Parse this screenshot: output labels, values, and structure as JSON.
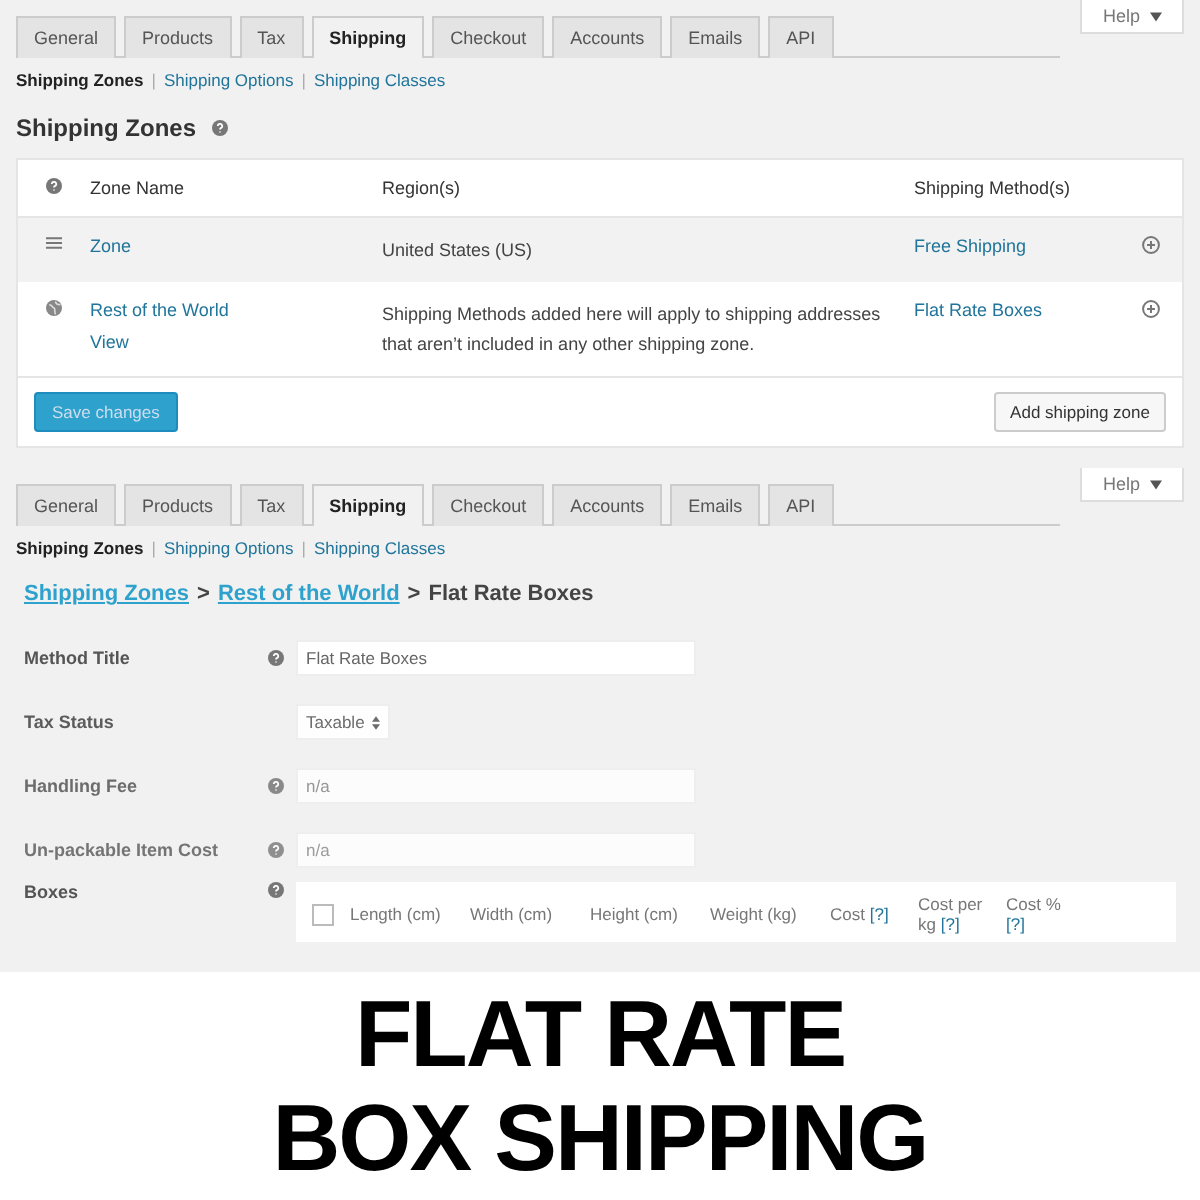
{
  "zones_screen": {
    "help_button": "Help",
    "tabs": [
      {
        "label": "General",
        "selected": false
      },
      {
        "label": "Products",
        "selected": false
      },
      {
        "label": "Tax",
        "selected": false
      },
      {
        "label": "Shipping",
        "selected": true
      },
      {
        "label": "Checkout",
        "selected": false
      },
      {
        "label": "Accounts",
        "selected": false
      },
      {
        "label": "Emails",
        "selected": false
      },
      {
        "label": "API",
        "selected": false
      }
    ],
    "subnav": [
      {
        "label": "Shipping Zones",
        "selected": true
      },
      {
        "label": "Shipping Options",
        "selected": false
      },
      {
        "label": "Shipping Classes",
        "selected": false
      }
    ],
    "subnav_separator": "|",
    "title": "Shipping Zones",
    "columns": [
      "Zone Name",
      "Region(s)",
      "Shipping Method(s)"
    ],
    "rows": [
      {
        "kind": "zone",
        "name": "Zone",
        "region": "United States (US)",
        "method": "Free Shipping",
        "highlighted": true
      },
      {
        "kind": "world",
        "name": "Rest of the World",
        "action": "View",
        "region": "Shipping Methods added here will apply to shipping addresses that aren’t included in any other shipping zone.",
        "method": "Flat Rate Boxes",
        "highlighted": false
      }
    ],
    "save_button": "Save changes",
    "add_button": "Add shipping zone"
  },
  "method_screen": {
    "help_button": "Help",
    "tabs": [
      {
        "label": "General",
        "selected": false
      },
      {
        "label": "Products",
        "selected": false
      },
      {
        "label": "Tax",
        "selected": false
      },
      {
        "label": "Shipping",
        "selected": true
      },
      {
        "label": "Checkout",
        "selected": false
      },
      {
        "label": "Accounts",
        "selected": false
      },
      {
        "label": "Emails",
        "selected": false
      },
      {
        "label": "API",
        "selected": false
      }
    ],
    "subnav": [
      {
        "label": "Shipping Zones",
        "selected": true
      },
      {
        "label": "Shipping Options",
        "selected": false
      },
      {
        "label": "Shipping Classes",
        "selected": false
      }
    ],
    "subnav_separator": "|",
    "breadcrumb_separator": ">",
    "breadcrumb": [
      {
        "label": "Shipping Zones",
        "link": true
      },
      {
        "label": "Rest of the World",
        "link": true
      },
      {
        "label": "Flat Rate Boxes",
        "link": false
      }
    ],
    "fields": [
      {
        "kind": "text",
        "label": "Method Title",
        "value": "Flat Rate Boxes"
      },
      {
        "kind": "select",
        "label": "Tax Status",
        "value": "Taxable"
      },
      {
        "kind": "text",
        "label": "Handling Fee",
        "placeholder": "n/a"
      },
      {
        "kind": "text",
        "label": "Un-packable Item Cost",
        "placeholder": "n/a"
      }
    ],
    "boxes": {
      "label": "Boxes",
      "checked": false,
      "columns": [
        {
          "label": "Length (cm)"
        },
        {
          "label": "Width (cm)"
        },
        {
          "label": "Height (cm)"
        },
        {
          "label": "Weight (kg)"
        },
        {
          "label": "Cost",
          "hint": "[?]"
        },
        {
          "label": "Cost per kg",
          "hint": "[?]"
        },
        {
          "label": "Cost %",
          "hint": "[?]"
        }
      ]
    }
  },
  "banner": {
    "lines": [
      "FLAT RATE",
      "BOX SHIPPING"
    ]
  }
}
